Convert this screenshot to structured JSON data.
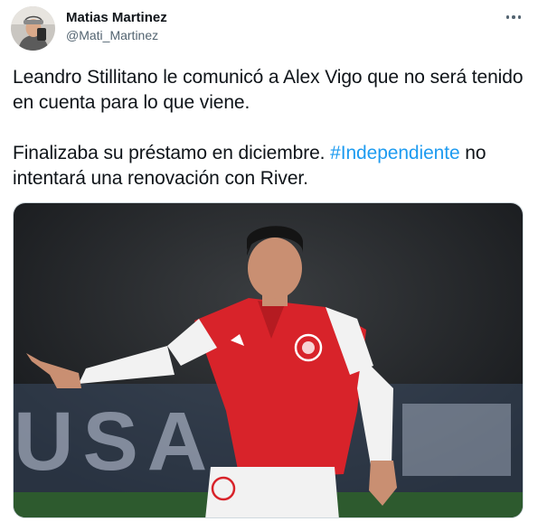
{
  "author": {
    "display_name": "Matias Martinez",
    "handle": "@Mati_Martinez",
    "avatar_icon": "user-avatar"
  },
  "more_icon": "ellipsis-icon",
  "tweet": {
    "line1": "Leandro Stillitano le comunicó a Alex Vigo que no será tenido en cuenta para lo que viene.",
    "line2_prefix": "Finalizaba su préstamo en diciembre. ",
    "hashtag": "#Independiente",
    "line2_suffix": " no intentará una renovación con River."
  },
  "media": {
    "photo_icon": "football-player-photo",
    "background_text": "USA"
  },
  "colors": {
    "link": "#1d9bf0",
    "secondary_text": "#536471",
    "jersey_red": "#d8232a"
  }
}
